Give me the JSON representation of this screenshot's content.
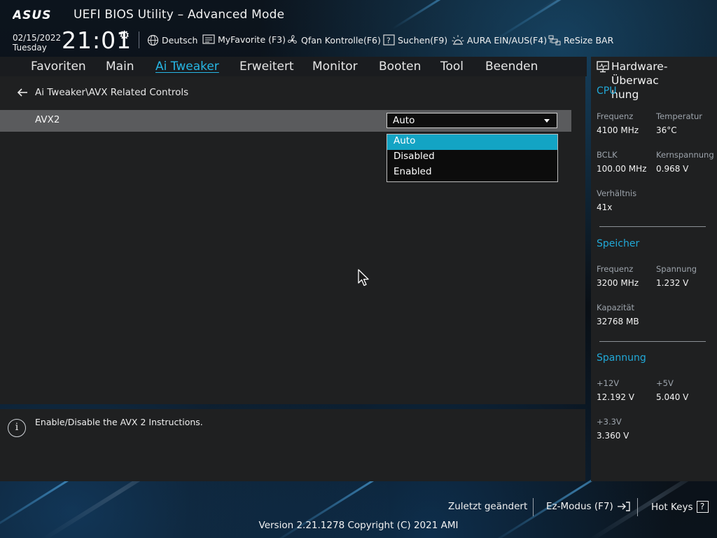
{
  "header": {
    "brand": "ASUS",
    "title": "UEFI BIOS Utility – Advanced Mode",
    "date": "02/15/2022",
    "weekday": "Tuesday",
    "time": "21:01",
    "tools": [
      {
        "label": "Deutsch",
        "icon": "globe-icon"
      },
      {
        "label": "MyFavorite (F3)",
        "icon": "favorite-list-icon"
      },
      {
        "label": "Qfan Kontrolle(F6)",
        "icon": "fan-icon"
      },
      {
        "label": "Suchen(F9)",
        "icon": "search-help-icon"
      },
      {
        "label": "AURA EIN/AUS(F4)",
        "icon": "aura-light-icon"
      },
      {
        "label": "ReSize BAR",
        "icon": "resize-bar-icon"
      }
    ]
  },
  "tabs": [
    {
      "label": "Favoriten",
      "active": false
    },
    {
      "label": "Main",
      "active": false
    },
    {
      "label": "Ai Tweaker",
      "active": true
    },
    {
      "label": "Erweitert",
      "active": false
    },
    {
      "label": "Monitor",
      "active": false
    },
    {
      "label": "Booten",
      "active": false
    },
    {
      "label": "Tool",
      "active": false
    },
    {
      "label": "Beenden",
      "active": false
    }
  ],
  "breadcrumb": "Ai Tweaker\\AVX Related Controls",
  "setting": {
    "label": "AVX2",
    "value": "Auto",
    "options": [
      "Auto",
      "Disabled",
      "Enabled"
    ],
    "selected_option": "Auto"
  },
  "help": {
    "text": "Enable/Disable the AVX 2 Instructions."
  },
  "hardware_monitor": {
    "title": "Hardware-Überwachung",
    "title_line1": "Hardware-Überwac",
    "title_line2": "hung",
    "cpu": {
      "heading": "CPU",
      "items": [
        {
          "label": "Frequenz",
          "value": "4100 MHz"
        },
        {
          "label": "Temperatur",
          "value": "36°C"
        },
        {
          "label": "BCLK",
          "value": "100.00 MHz"
        },
        {
          "label": "Kernspannung",
          "value": "0.968 V"
        },
        {
          "label": "Verhältnis",
          "value": "41x"
        }
      ]
    },
    "memory": {
      "heading": "Speicher",
      "items": [
        {
          "label": "Frequenz",
          "value": "3200 MHz"
        },
        {
          "label": "Spannung",
          "value": "1.232 V"
        },
        {
          "label": "Kapazität",
          "value": "32768 MB"
        }
      ]
    },
    "voltage": {
      "heading": "Spannung",
      "items": [
        {
          "label": "+12V",
          "value": "12.192 V"
        },
        {
          "label": "+5V",
          "value": "5.040 V"
        },
        {
          "label": "+3.3V",
          "value": "3.360 V"
        }
      ]
    }
  },
  "footer": {
    "last_modified": "Zuletzt geändert",
    "ez_mode": "Ez-Modus (F7)",
    "hot_keys": "Hot Keys",
    "hot_keys_glyph": "?",
    "version": "Version 2.21.1278 Copyright (C) 2021 AMI"
  },
  "colors": {
    "accent": "#27b6e4",
    "selected_option_bg": "#13a4c4",
    "panel_bg": "#1f2021",
    "row_highlight": "#5a5b5d"
  }
}
